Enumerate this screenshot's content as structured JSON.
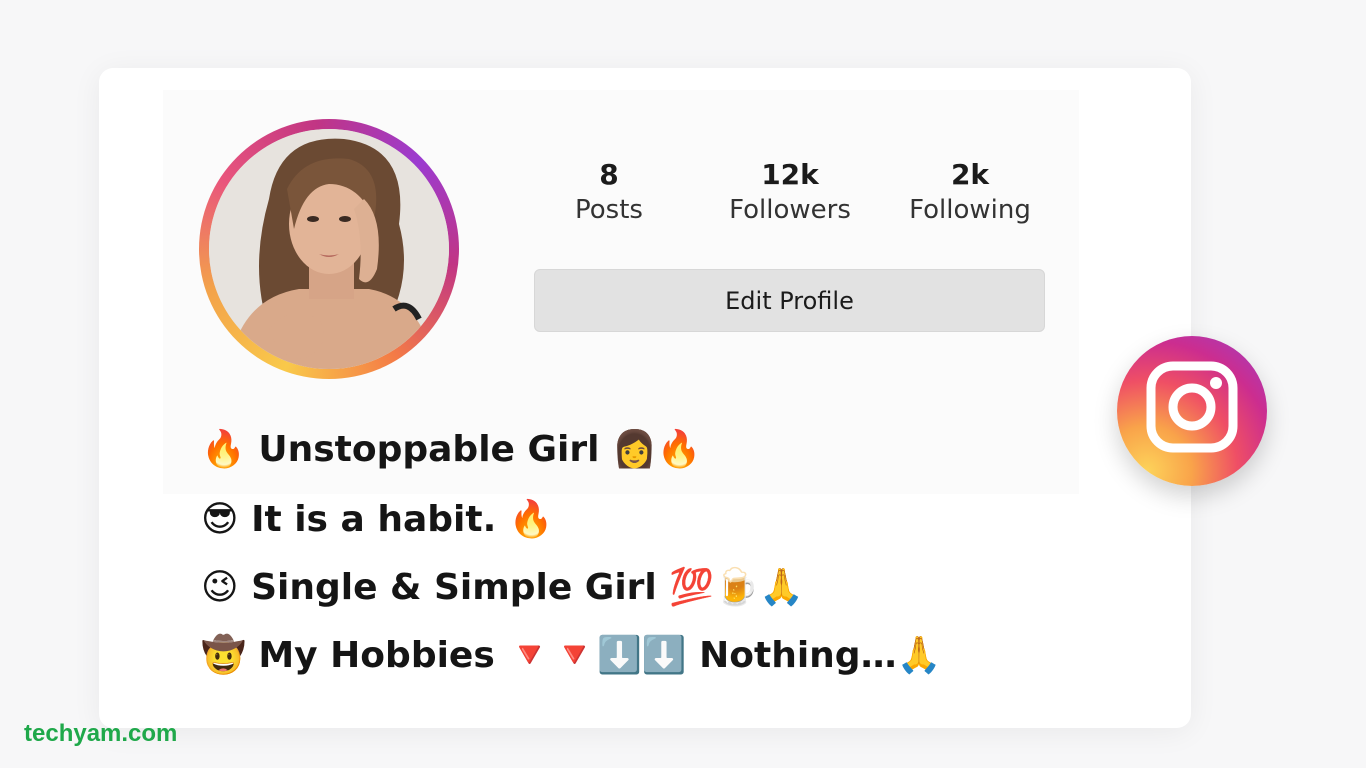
{
  "profile": {
    "stats": [
      {
        "value": "8",
        "label": "Posts"
      },
      {
        "value": "12k",
        "label": "Followers"
      },
      {
        "value": "2k",
        "label": "Following"
      }
    ],
    "edit_button_label": "Edit Profile",
    "bio_lines": [
      "🔥 Unstoppable Girl 👩🔥",
      "😎 It is a habit. 🔥",
      "😉 Single & Simple Girl 💯🍺🙏",
      "🤠 My Hobbies 🔻🔻⬇️⬇️ Nothing…🙏"
    ]
  },
  "badge": {
    "icon": "instagram-icon"
  },
  "watermark": "techyam.com",
  "colors": {
    "watermark": "#1fa84a",
    "button_bg": "#e2e2e2"
  }
}
